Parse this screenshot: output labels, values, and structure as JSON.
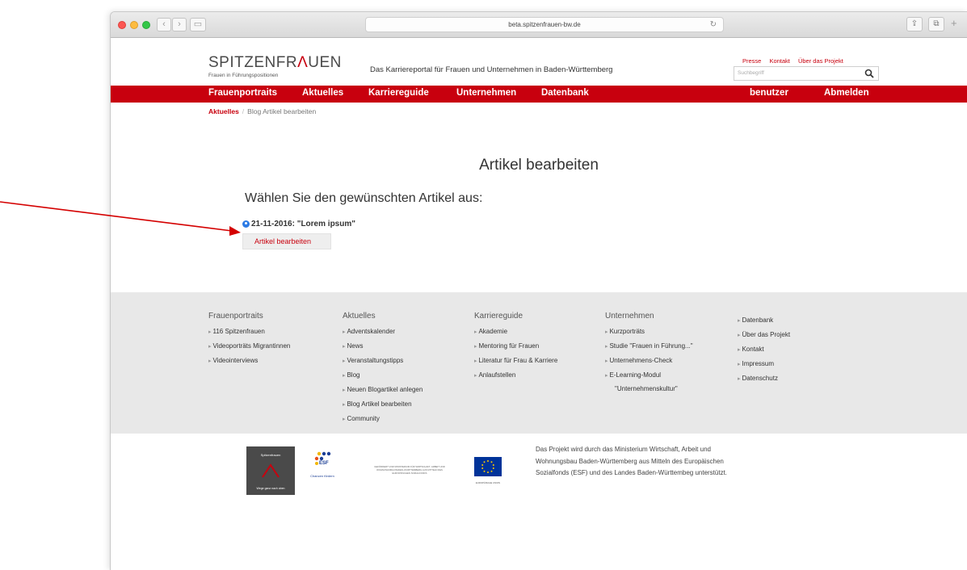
{
  "browser": {
    "url": "beta.spitzenfrauen-bw.de",
    "back_icon": "chevron-left-icon",
    "forward_icon": "chevron-right-icon"
  },
  "header": {
    "logo_main": "SPITZENFR",
    "logo_accent": "Λ",
    "logo_end": "UEN",
    "logo_sub": "Frauen in Führungspositionen",
    "tagline": "Das Karriereportal für Frauen und Unternehmen in Baden-Württemberg",
    "top_links": [
      "Presse",
      "Kontakt",
      "Über das Projekt"
    ],
    "search_placeholder": "Suchbegriff"
  },
  "nav": {
    "items": [
      "Frauenportraits",
      "Aktuelles",
      "Karriereguide",
      "Unternehmen",
      "Datenbank"
    ],
    "user": "benutzer",
    "logout": "Abmelden"
  },
  "breadcrumb": {
    "link": "Aktuelles",
    "separator": "/",
    "current": "Blog Artikel bearbeiten"
  },
  "main": {
    "title": "Artikel bearbeiten",
    "subheading": "Wählen Sie den gewünschten Artikel aus:",
    "article": "21-11-2016: \"Lorem ipsum\"",
    "edit_button": "Artikel bearbeiten"
  },
  "footer": {
    "columns": [
      {
        "title": "Frauenportraits",
        "items": [
          "116 Spitzenfrauen",
          "Videoporträts Migrantinnen",
          "Videointerviews"
        ]
      },
      {
        "title": "Aktuelles",
        "items": [
          "Adventskalender",
          "News",
          "Veranstaltungstipps",
          "Blog",
          "Neuen Blogartikel anlegen",
          "Blog Artikel bearbeiten",
          "Community"
        ]
      },
      {
        "title": "Karriereguide",
        "items": [
          "Akademie",
          "Mentoring für Frauen",
          "Literatur für Frau & Karriere",
          "Anlaufstellen"
        ]
      },
      {
        "title": "Unternehmen",
        "items": [
          "Kurzporträts",
          "Studie \"Frauen in Führung...\"",
          "Unternehmens-Check",
          "E-Learning-Modul",
          "\"Unternehmenskultur\""
        ]
      },
      {
        "title": "",
        "items": [
          "Datenbank",
          "Über das Projekt",
          "Kontakt",
          "Impressum",
          "Datenschutz"
        ]
      }
    ],
    "ministry_text": [
      "Das Projekt wird durch das Ministerium Wirtschaft, Arbeit und",
      "Wohnungsbau Baden-Württemberg aus Mitteln des Europäischen",
      "Sozialfonds (ESF) und des Landes Baden-Württembeg unterstützt."
    ],
    "logo1_text": "Spitzenfrauen",
    "logo1_sub": "Wege ganz nach oben",
    "esf_text": "ESF",
    "esf_sub": "Chancen fördern",
    "ministry_logo_text": "GEFÖRDERT VOM MINISTERIUM FÜR WIRTSCHAFT, ARBEIT UND WOHNUNGSBAU BADEN-WÜRTTEMBERG AUS MITTELN DES EUROPÄISCHEN SOZIALFONDS",
    "eu_text": "EUROPÄISCHE UNION"
  },
  "colors": {
    "brand_red": "#c8000e",
    "footer_bg": "#e8e8e8",
    "eu_blue": "#003399"
  }
}
